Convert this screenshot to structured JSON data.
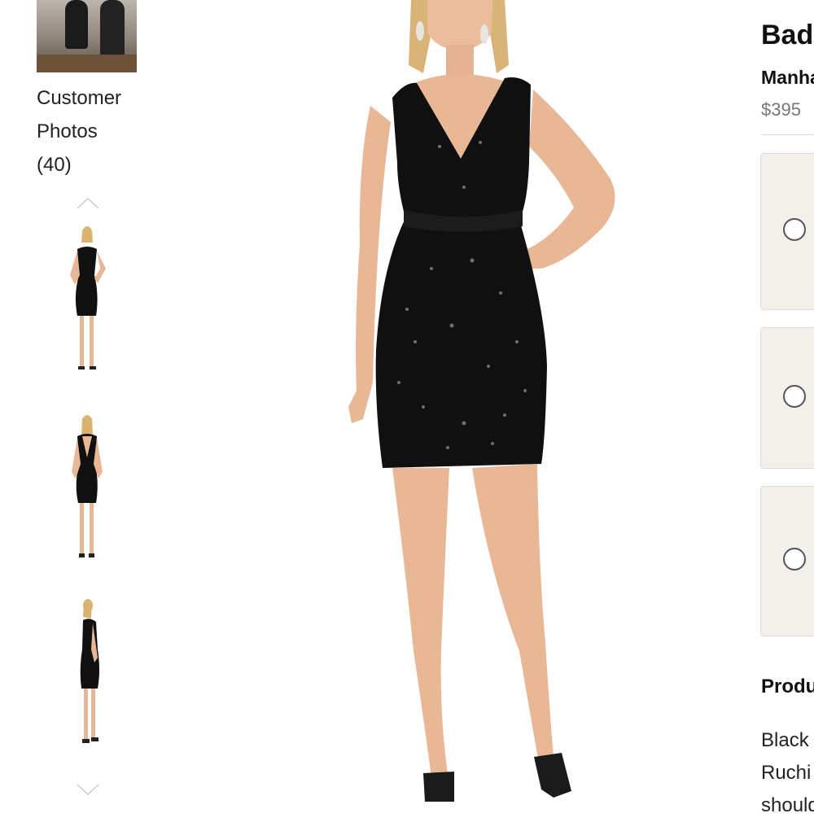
{
  "gallery": {
    "customer_photos_label_line1": "Customer",
    "customer_photos_label_line2": "Photos",
    "customer_photos_count": "(40)",
    "thumbnails": [
      "front-view",
      "back-view",
      "side-view"
    ]
  },
  "product": {
    "title": "Badg",
    "brand": "Manha",
    "price": "$395",
    "section_heading": "Produ",
    "description_lines": [
      "Black",
      "Ruchi",
      "should"
    ]
  },
  "colors": {
    "option_bg": "#f3efeb",
    "price_text": "#777777",
    "dress": "#111111",
    "skin": "#e8b896"
  },
  "icons": {
    "up": "chevron-up-icon",
    "down": "chevron-down-icon",
    "radio": "radio-icon"
  }
}
